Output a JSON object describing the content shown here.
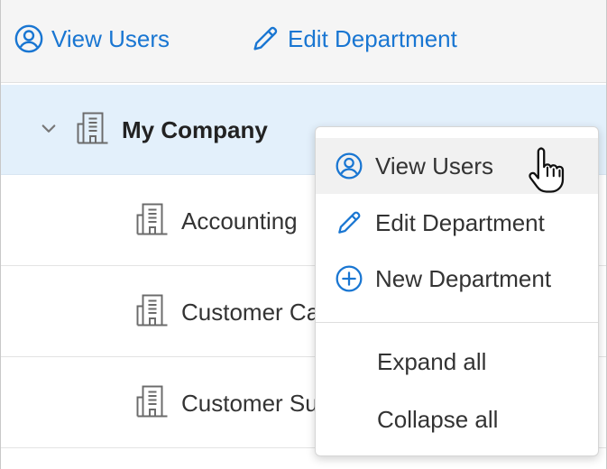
{
  "toolbar": {
    "view_users": "View Users",
    "edit_department": "Edit Department"
  },
  "tree": {
    "root": {
      "label": "My Company",
      "expanded": true,
      "selected": true
    },
    "children": [
      {
        "label": "Accounting"
      },
      {
        "label": "Customer Care"
      },
      {
        "label": "Customer Support"
      }
    ]
  },
  "context_menu": {
    "items": [
      {
        "label": "View Users",
        "icon": "user-circle-icon",
        "hovered": true
      },
      {
        "label": "Edit Department",
        "icon": "pencil-icon"
      },
      {
        "label": "New Department",
        "icon": "plus-circle-icon"
      }
    ],
    "secondary": [
      {
        "label": "Expand all"
      },
      {
        "label": "Collapse all"
      }
    ]
  },
  "colors": {
    "accent": "#1976d2",
    "selected_row": "#e3f0fb",
    "toolbar_bg": "#f5f5f5"
  }
}
